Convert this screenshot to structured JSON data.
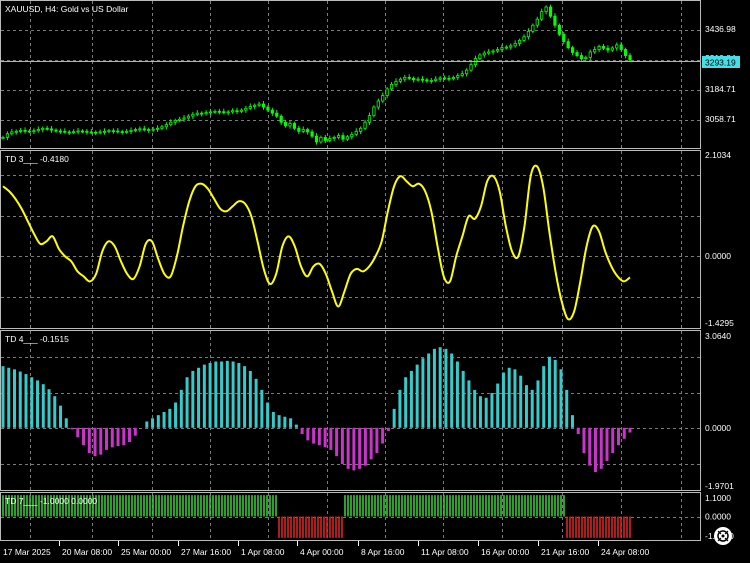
{
  "chart_data": [
    {
      "type": "candlestick",
      "title": "XAUUSD, H4:  Gold vs US Dollar",
      "price_ticks": [
        "3436.98",
        "3310.84",
        "3184.71",
        "3058.71"
      ],
      "current_price": "3293.19",
      "ylim": [
        3005,
        3490
      ],
      "close_approx": [
        3040,
        3052,
        3058,
        3060,
        3063,
        3061,
        3060,
        3062,
        3066,
        3070,
        3068,
        3064,
        3061,
        3060,
        3058,
        3057,
        3059,
        3061,
        3060,
        3058,
        3057,
        3056,
        3058,
        3060,
        3062,
        3061,
        3059,
        3058,
        3060,
        3063,
        3066,
        3068,
        3066,
        3064,
        3067,
        3070,
        3075,
        3082,
        3090,
        3096,
        3100,
        3104,
        3110,
        3116,
        3120,
        3118,
        3122,
        3124,
        3126,
        3125,
        3122,
        3124,
        3128,
        3126,
        3130,
        3136,
        3142,
        3146,
        3150,
        3140,
        3130,
        3120,
        3110,
        3090,
        3078,
        3086,
        3070,
        3060,
        3066,
        3058,
        3044,
        3025,
        3040,
        3030,
        3036,
        3040,
        3046,
        3034,
        3042,
        3050,
        3060,
        3070,
        3090,
        3112,
        3140,
        3160,
        3178,
        3200,
        3215,
        3225,
        3232,
        3238,
        3235,
        3230,
        3232,
        3230,
        3226,
        3228,
        3232,
        3236,
        3235,
        3234,
        3238,
        3244,
        3250,
        3262,
        3280,
        3300,
        3312,
        3318,
        3322,
        3325,
        3330,
        3336,
        3338,
        3342,
        3350,
        3360,
        3372,
        3390,
        3410,
        3430,
        3455,
        3470,
        3440,
        3410,
        3380,
        3356,
        3336,
        3320,
        3310,
        3300,
        3304,
        3322,
        3330,
        3340,
        3334,
        3328,
        3335,
        3345,
        3330,
        3310,
        3295
      ]
    },
    {
      "type": "line",
      "indicator_label": "TD 3___  -0.4180",
      "ticks": [
        "2.1034",
        "0.0000",
        "-1.4295"
      ],
      "ylim": [
        -1.4295,
        2.1034
      ],
      "color": "#ffff00",
      "values_approx": [
        1.4,
        1.3,
        1.15,
        0.95,
        0.7,
        0.45,
        0.25,
        0.3,
        0.4,
        0.15,
        0.0,
        -0.1,
        -0.3,
        -0.4,
        -0.5,
        -0.35,
        0.1,
        0.3,
        0.2,
        -0.1,
        -0.35,
        -0.45,
        -0.2,
        0.25,
        0.3,
        -0.05,
        -0.35,
        -0.4,
        0.0,
        0.6,
        1.1,
        1.4,
        1.45,
        1.35,
        1.15,
        0.95,
        0.9,
        1.0,
        1.1,
        1.05,
        0.8,
        0.3,
        -0.25,
        -0.55,
        -0.35,
        0.2,
        0.4,
        0.2,
        -0.2,
        -0.4,
        -0.2,
        -0.15,
        -0.35,
        -0.7,
        -1.0,
        -0.7,
        -0.35,
        -0.25,
        -0.3,
        -0.2,
        0.0,
        0.3,
        0.9,
        1.4,
        1.6,
        1.5,
        1.4,
        1.45,
        1.3,
        0.9,
        0.2,
        -0.4,
        -0.5,
        0.0,
        0.4,
        0.8,
        0.75,
        1.0,
        1.5,
        1.6,
        1.3,
        0.6,
        0.1,
        0.0,
        0.6,
        1.6,
        1.8,
        1.4,
        0.5,
        -0.3,
        -0.9,
        -1.25,
        -1.1,
        -0.5,
        0.2,
        0.6,
        0.5,
        0.1,
        -0.2,
        -0.4,
        -0.5,
        -0.42
      ]
    },
    {
      "type": "bar",
      "indicator_label": "TD 4___  -0.1515",
      "ticks": [
        "3.0640",
        "0.0000",
        "-1.9701"
      ],
      "ylim": [
        -1.9701,
        3.064
      ],
      "positive_color": "#33cccc",
      "negative_color": "#cc33cc",
      "values_approx": [
        1.95,
        1.9,
        1.85,
        1.78,
        1.7,
        1.6,
        1.5,
        1.38,
        1.22,
        1.0,
        0.7,
        0.3,
        -0.05,
        -0.3,
        -0.55,
        -0.8,
        -0.9,
        -0.85,
        -0.7,
        -0.62,
        -0.58,
        -0.55,
        -0.45,
        -0.25,
        0.0,
        0.2,
        0.3,
        0.4,
        0.5,
        0.6,
        0.8,
        1.2,
        1.6,
        1.8,
        1.9,
        2.0,
        2.05,
        2.1,
        2.1,
        2.12,
        2.1,
        2.05,
        1.95,
        1.8,
        1.55,
        1.2,
        0.8,
        0.5,
        0.4,
        0.35,
        0.3,
        0.1,
        -0.2,
        -0.4,
        -0.5,
        -0.55,
        -0.62,
        -0.7,
        -0.9,
        -1.15,
        -1.3,
        -1.35,
        -1.3,
        -1.2,
        -1.0,
        -0.8,
        -0.5,
        -0.1,
        0.6,
        1.2,
        1.6,
        1.8,
        2.0,
        2.2,
        2.35,
        2.5,
        2.55,
        2.5,
        2.35,
        2.1,
        1.8,
        1.5,
        1.2,
        1.0,
        0.95,
        1.1,
        1.4,
        1.75,
        1.9,
        1.85,
        1.65,
        1.35,
        1.2,
        1.5,
        1.95,
        2.25,
        2.15,
        1.85,
        1.2,
        0.4,
        -0.2,
        -0.8,
        -1.2,
        -1.4,
        -1.3,
        -1.05,
        -0.8,
        -0.55,
        -0.35,
        -0.15
      ]
    },
    {
      "type": "bar",
      "indicator_label": "TD 7___  -1.0000  0.0000",
      "ticks": [
        "1.1000",
        "0.0000",
        "-1.1000"
      ],
      "ylim": [
        -1.1,
        1.1
      ],
      "positive_color": "#33cc33",
      "negative_color": "#dd2222",
      "segments": [
        {
          "start": 0.0,
          "end": 0.4395,
          "value": 1
        },
        {
          "start": 0.4395,
          "end": 0.5435,
          "value": -1
        },
        {
          "start": 0.5435,
          "end": 0.8975,
          "value": 1
        },
        {
          "start": 0.8975,
          "end": 1.0,
          "value": -1
        }
      ]
    }
  ],
  "time_axis": {
    "labels": [
      "17 Mar 2025",
      "20 Mar 08:00",
      "25 Mar 00:00",
      "27 Mar 16:00",
      "1 Apr 08:00",
      "4 Apr 00:00",
      "8 Apr 16:00",
      "11 Apr 08:00",
      "16 Apr 00:00",
      "21 Apr 16:00",
      "24 Apr 08:00"
    ]
  },
  "colors": {
    "background": "#000000",
    "grid": "#7a7a7a",
    "border": "#bbbbbb",
    "text": "#ffffff",
    "candle": "#00ff00",
    "price_line": "#44e0e8",
    "price_tag_bg": "#44e0e8"
  },
  "icons": {
    "autoscroll": "autoscroll-icon"
  }
}
